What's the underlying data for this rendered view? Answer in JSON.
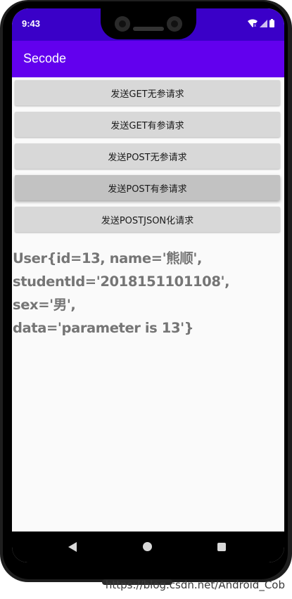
{
  "status_bar": {
    "time": "9:43",
    "icons": [
      "wifi-icon",
      "signal-icon",
      "battery-icon"
    ]
  },
  "app_bar": {
    "title": "Secode",
    "color": "#6200ee"
  },
  "buttons": [
    {
      "label": "发送GET无参请求"
    },
    {
      "label": "发送GET有参请求"
    },
    {
      "label": "发送POST无参请求"
    },
    {
      "label": "发送POST有参请求"
    },
    {
      "label": "发送POSTJSON化请求"
    }
  ],
  "result_text": "User{id=13, name='熊顺',\nstudentId='2018151101108', sex='男',\ndata='parameter is 13'}",
  "nav_bar": {
    "icons": [
      "back-icon",
      "home-icon",
      "recents-icon"
    ]
  },
  "watermark": "https://blog.csdn.net/Android_Cob"
}
